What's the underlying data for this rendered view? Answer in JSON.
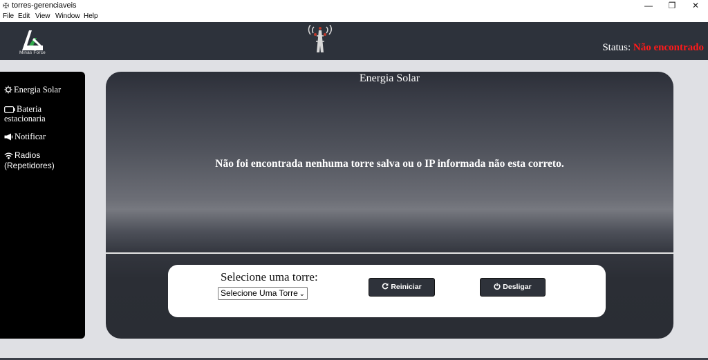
{
  "window": {
    "title": "torres-gerenciaveis",
    "minimize": "—",
    "maximize": "❐",
    "close": "✕"
  },
  "menu": [
    "File",
    "Edit",
    "View",
    "Window",
    "Help"
  ],
  "header": {
    "logo_text": "Minas Force",
    "status_label": "Status:",
    "status_value": "Não encontrado"
  },
  "sidebar": {
    "items": [
      {
        "label": "Energia Solar",
        "icon": "sun-icon"
      },
      {
        "label": "Bateria estacionaria",
        "icon": "battery-icon"
      },
      {
        "label": "Notificar",
        "icon": "megaphone-icon"
      },
      {
        "label": "Radios (Repetidores)",
        "icon": "wifi-icon"
      }
    ]
  },
  "main": {
    "title": "Energia Solar",
    "message": "Não foi encontrada nenhuma torre salva ou o IP informada não esta correto.",
    "select_label": "Selecione uma torre:",
    "select_value": "Selecione Uma Torre",
    "restart_label": "Reiniciar",
    "shutdown_label": "Desligar"
  },
  "colors": {
    "header_bg": "#2d323b",
    "status_value": "#ff1a1a",
    "sidebar_bg": "#000000",
    "page_bg": "#dfe0e4"
  }
}
